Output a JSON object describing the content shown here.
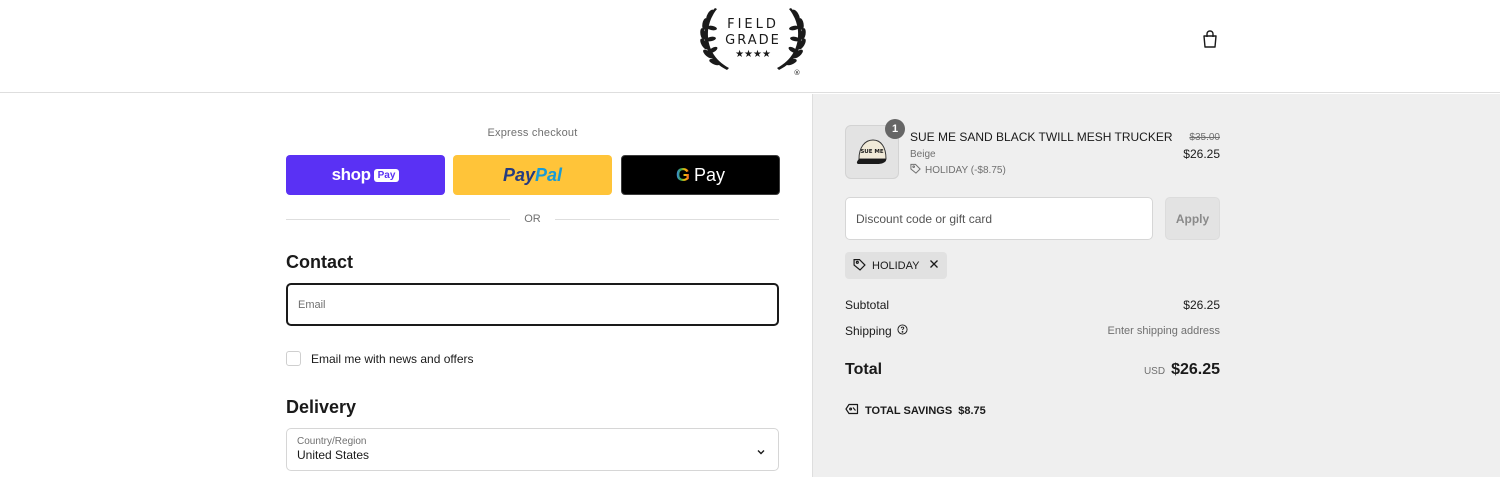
{
  "header": {
    "logo": {
      "line1": "FIELD",
      "line2": "GRADE",
      "stars": "★★★★",
      "registered": "®"
    },
    "cart_icon": "shopping-bag-icon"
  },
  "express_checkout": {
    "label": "Express checkout",
    "shop_pay": {
      "word": "shop",
      "badge": "Pay"
    },
    "paypal": {
      "part1": "Pay",
      "part2": "Pal"
    },
    "google_pay": {
      "g": "G",
      "word": "Pay"
    },
    "divider": "OR"
  },
  "contact": {
    "title": "Contact",
    "email_placeholder": "Email",
    "newsletter_label": "Email me with news and offers"
  },
  "delivery": {
    "title": "Delivery",
    "country_caption": "Country/Region",
    "country_value": "United States"
  },
  "summary": {
    "item": {
      "quantity": "1",
      "name": "SUE ME SAND BLACK TWILL MESH TRUCKER",
      "variant": "Beige",
      "discount": "HOLIDAY (-$8.75)",
      "original_price": "$35.00",
      "price": "$26.25",
      "thumbnail_text": "SUE ME"
    },
    "discount_placeholder": "Discount code or gift card",
    "apply_label": "Apply",
    "applied_code": "HOLIDAY",
    "subtotal_label": "Subtotal",
    "subtotal_value": "$26.25",
    "shipping_label": "Shipping",
    "shipping_value": "Enter shipping address",
    "total_label": "Total",
    "total_currency": "USD",
    "total_value": "$26.25",
    "savings_label": "TOTAL SAVINGS",
    "savings_value": "$8.75"
  },
  "colors": {
    "shop_pay": "#5a31f4",
    "paypal": "#ffc439",
    "google_pay": "#000000",
    "summary_bg": "#efefef"
  }
}
